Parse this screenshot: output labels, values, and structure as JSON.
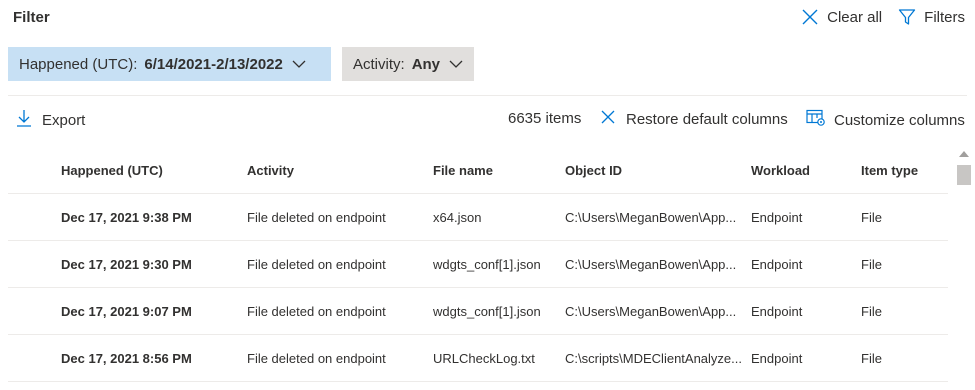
{
  "filter": {
    "title": "Filter",
    "clear_all_label": "Clear all",
    "filters_label": "Filters",
    "pills": [
      {
        "label": "Happened (UTC):",
        "value": "6/14/2021-2/13/2022"
      },
      {
        "label": "Activity:",
        "value": "Any"
      }
    ]
  },
  "toolbar": {
    "export_label": "Export",
    "item_count": "6635 items",
    "restore_label": "Restore default columns",
    "customize_label": "Customize columns"
  },
  "table": {
    "columns": [
      "Happened (UTC)",
      "Activity",
      "File name",
      "Object ID",
      "Workload",
      "Item type"
    ],
    "rows": [
      [
        "Dec 17, 2021 9:38 PM",
        "File deleted on endpoint",
        "x64.json",
        "C:\\Users\\MeganBowen\\App...",
        "Endpoint",
        "File"
      ],
      [
        "Dec 17, 2021 9:30 PM",
        "File deleted on endpoint",
        "wdgts_conf[1].json",
        "C:\\Users\\MeganBowen\\App...",
        "Endpoint",
        "File"
      ],
      [
        "Dec 17, 2021 9:07 PM",
        "File deleted on endpoint",
        "wdgts_conf[1].json",
        "C:\\Users\\MeganBowen\\App...",
        "Endpoint",
        "File"
      ],
      [
        "Dec 17, 2021 8:56 PM",
        "File deleted on endpoint",
        "URLCheckLog.txt",
        "C:\\scripts\\MDEClientAnalyze...",
        "Endpoint",
        "File"
      ]
    ]
  },
  "colors": {
    "accent": "#0078d4",
    "active_pill": "#c7e0f4",
    "neutral_pill": "#e1dfdd"
  },
  "icons": {
    "clear": "close-icon",
    "filters": "filter-icon",
    "pill": "chevron-down-icon",
    "export": "download-icon",
    "restore": "close-icon",
    "customize": "customize-columns-icon"
  }
}
